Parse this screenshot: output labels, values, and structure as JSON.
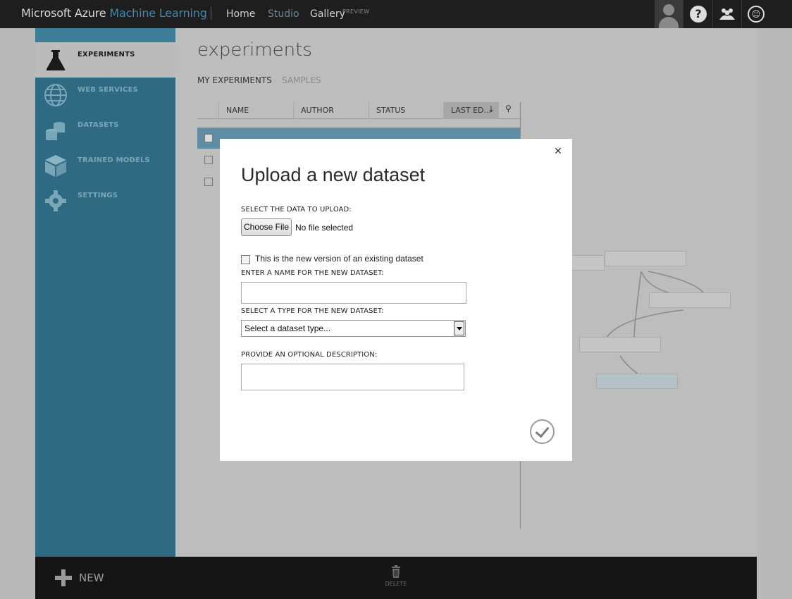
{
  "topbar": {
    "brand_primary": "Microsoft Azure",
    "brand_secondary": "Machine Learning",
    "nav": [
      "Home",
      "Studio",
      "Gallery"
    ],
    "preview_badge": "PREVIEW"
  },
  "sidebar": {
    "items": [
      {
        "label": "EXPERIMENTS",
        "icon": "flask-icon",
        "active": true
      },
      {
        "label": "WEB SERVICES",
        "icon": "globe-icon",
        "active": false
      },
      {
        "label": "DATASETS",
        "icon": "database-icon",
        "active": false
      },
      {
        "label": "TRAINED MODELS",
        "icon": "cube-icon",
        "active": false
      },
      {
        "label": "SETTINGS",
        "icon": "gear-icon",
        "active": false
      }
    ]
  },
  "main": {
    "title": "experiments",
    "tabs": [
      "MY EXPERIMENTS",
      "SAMPLES"
    ],
    "columns": [
      "NAME",
      "AUTHOR",
      "STATUS",
      "LAST ED..."
    ]
  },
  "bottombar": {
    "new_label": "NEW",
    "delete_label": "DELETE"
  },
  "modal": {
    "title": "Upload a new dataset",
    "select_data_label": "SELECT THE DATA TO UPLOAD:",
    "choose_file_button": "Choose File",
    "file_status": "No file selected",
    "new_version_checkbox_label": "This is the new version of an existing dataset",
    "new_version_checked": false,
    "name_label": "ENTER A NAME FOR THE NEW DATASET:",
    "name_value": "",
    "type_label": "SELECT A TYPE FOR THE NEW DATASET:",
    "type_selected": "Select a dataset type...",
    "description_label": "PROVIDE AN OPTIONAL DESCRIPTION:",
    "description_value": ""
  },
  "colors": {
    "topbar_bg": "#1e1e1e",
    "brand_accent": "#3e8ab0",
    "sidebar_bg": "#2e6a82",
    "modal_bg": "#ffffff",
    "overlay_dim": "#b9b9b9"
  }
}
